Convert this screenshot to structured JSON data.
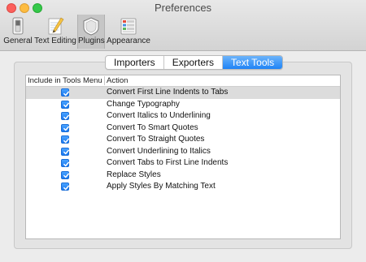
{
  "window": {
    "title": "Preferences"
  },
  "toolbar": {
    "items": [
      {
        "label": "General",
        "icon": "switch-icon",
        "selected": false
      },
      {
        "label": "Text Editing",
        "icon": "pencil-notepad-icon",
        "selected": false
      },
      {
        "label": "Plugins",
        "icon": "plugin-shield-icon",
        "selected": true
      },
      {
        "label": "Appearance",
        "icon": "appearance-panel-icon",
        "selected": false
      }
    ]
  },
  "tabs": [
    {
      "label": "Importers",
      "active": false
    },
    {
      "label": "Exporters",
      "active": false
    },
    {
      "label": "Text Tools",
      "active": true
    }
  ],
  "table": {
    "columns": [
      "Include in Tools Menu",
      "Action"
    ],
    "rows": [
      {
        "checked": true,
        "action": "Convert First Line Indents to Tabs",
        "selected": true
      },
      {
        "checked": true,
        "action": "Change Typography",
        "selected": false
      },
      {
        "checked": true,
        "action": "Convert Italics to Underlining",
        "selected": false
      },
      {
        "checked": true,
        "action": "Convert To Smart Quotes",
        "selected": false
      },
      {
        "checked": true,
        "action": "Convert To Straight Quotes",
        "selected": false
      },
      {
        "checked": true,
        "action": "Convert Underlining to Italics",
        "selected": false
      },
      {
        "checked": true,
        "action": "Convert Tabs to First Line Indents",
        "selected": false
      },
      {
        "checked": true,
        "action": "Replace Styles",
        "selected": false
      },
      {
        "checked": true,
        "action": "Apply Styles By Matching Text",
        "selected": false
      }
    ]
  },
  "colors": {
    "accent": "#1f83f6",
    "selected_row": "#dcdcdc"
  }
}
